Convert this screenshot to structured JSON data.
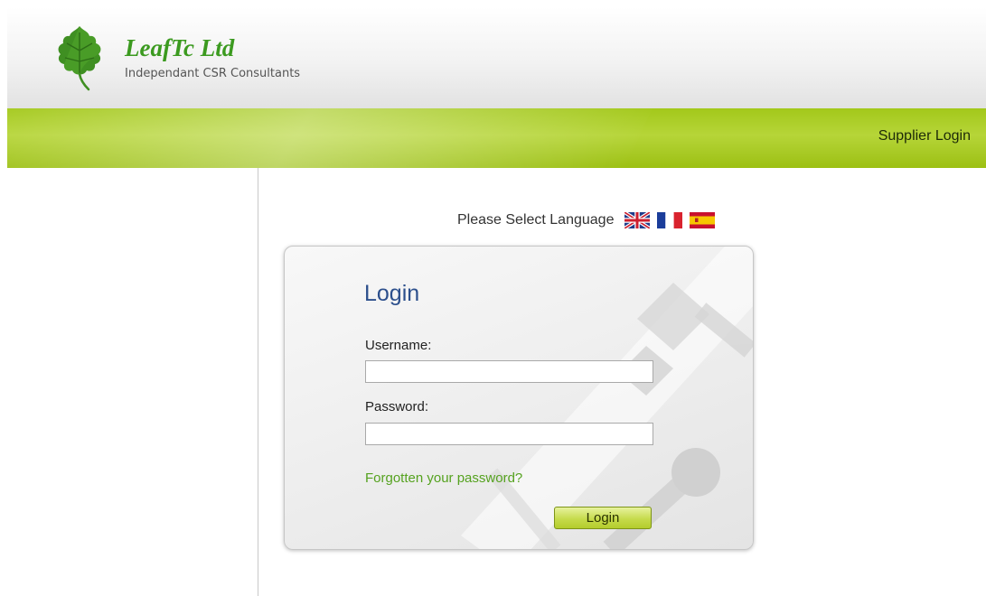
{
  "header": {
    "company_name": "LeafTc Ltd",
    "tagline": "Independant CSR Consultants",
    "logo_icon": "leaf-icon"
  },
  "nav": {
    "supplier_login": "Supplier Login"
  },
  "language": {
    "prompt": "Please Select Language",
    "flags": [
      "uk-flag-icon",
      "france-flag-icon",
      "spain-flag-icon"
    ]
  },
  "login": {
    "title": "Login",
    "username_label": "Username:",
    "username_value": "",
    "password_label": "Password:",
    "password_value": "",
    "forgot_link": "Forgotten your password?",
    "submit_label": "Login"
  },
  "colors": {
    "brand_green": "#3b9a1f",
    "nav_green": "#a3c81a",
    "title_blue": "#2c4f8c",
    "link_green": "#55a21f"
  }
}
